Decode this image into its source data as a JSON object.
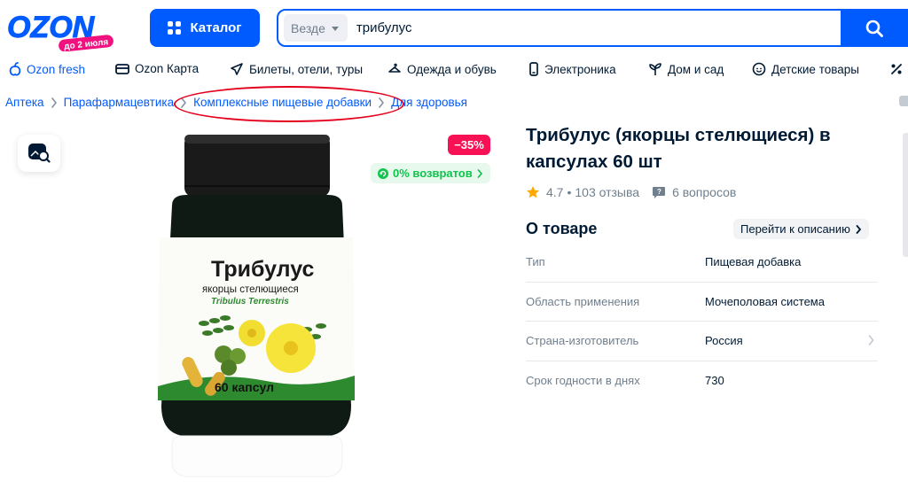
{
  "brand": {
    "logo_text": "OZON",
    "logo_sub": "до 2 июля",
    "colors": {
      "primary": "#005bff",
      "logo_pink": "#f1117e",
      "discount": "#f91155",
      "success": "#10c44c",
      "highlight": "#e4001c"
    }
  },
  "header": {
    "catalog_label": "Каталог",
    "search": {
      "scope": "Везде",
      "value": "трибулус"
    }
  },
  "nav": [
    {
      "label": "Ozon fresh",
      "icon": "fresh-icon",
      "accent": true
    },
    {
      "label": "Ozon Карта",
      "icon": "card-icon"
    },
    {
      "label": "Билеты, отели, туры",
      "icon": "plane-icon"
    },
    {
      "label": "Одежда и обувь",
      "icon": "clothes-icon"
    },
    {
      "label": "Электроника",
      "icon": "phone-icon"
    },
    {
      "label": "Дом и сад",
      "icon": "plant-icon"
    },
    {
      "label": "Детские товары",
      "icon": "baby-icon"
    },
    {
      "label": "",
      "icon": "percent-icon"
    }
  ],
  "breadcrumb": [
    "Аптека",
    "Парафармацевтика",
    "Комплексные пищевые добавки",
    "Для здоровья"
  ],
  "product": {
    "image_icon": "supplement-jar-image",
    "label_texts": {
      "name": "Трибулус",
      "sub": "якорцы стелющиеся",
      "latin": "Tribulus Terrestris",
      "count": "60 капсул"
    },
    "discount": "−35%",
    "returns": "0% возвратов",
    "title": "Трибулус (якорцы стелющиеся) в капсулах 60 шт",
    "rating": "4.7",
    "reviews": "103 отзыва",
    "questions": "6 вопросов"
  },
  "about": {
    "title": "О товаре",
    "goto_label": "Перейти к описанию",
    "specs": [
      {
        "label": "Тип",
        "value": "Пищевая добавка"
      },
      {
        "label": "Область применения",
        "value": "Мочеполовая система"
      },
      {
        "label": "Страна-изготовитель",
        "value": "Россия",
        "arrow": true
      },
      {
        "label": "Срок годности в днях",
        "value": "730"
      }
    ]
  }
}
